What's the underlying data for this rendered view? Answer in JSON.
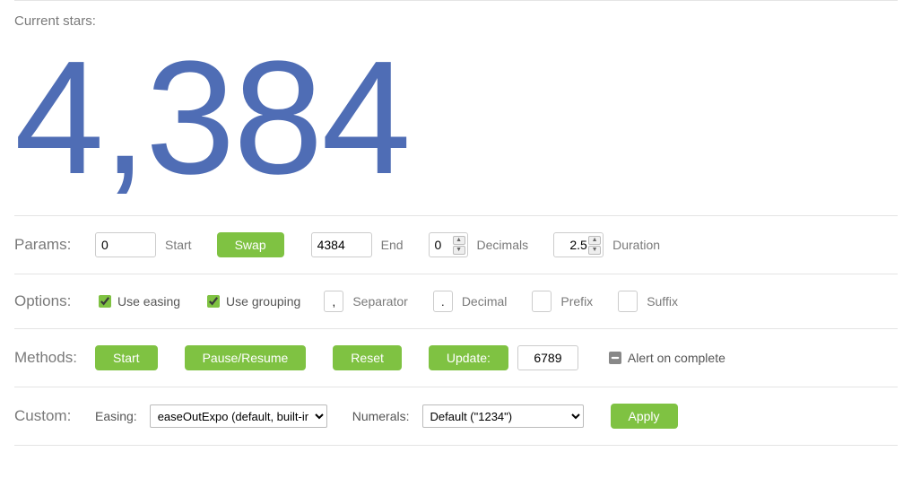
{
  "current": {
    "label": "Current stars:",
    "value": "4,384"
  },
  "params": {
    "section_label": "Params:",
    "start_value": "0",
    "start_label": "Start",
    "swap_button": "Swap",
    "end_value": "4384",
    "end_label": "End",
    "decimals_value": "0",
    "decimals_label": "Decimals",
    "duration_value": "2.5",
    "duration_label": "Duration"
  },
  "options": {
    "section_label": "Options:",
    "use_easing_label": "Use easing",
    "use_grouping_label": "Use grouping",
    "separator_value": ",",
    "separator_label": "Separator",
    "decimal_value": ".",
    "decimal_label": "Decimal",
    "prefix_value": "",
    "prefix_label": "Prefix",
    "suffix_value": "",
    "suffix_label": "Suffix"
  },
  "methods": {
    "section_label": "Methods:",
    "start_button": "Start",
    "pause_resume_button": "Pause/Resume",
    "reset_button": "Reset",
    "update_button": "Update:",
    "update_value": "6789",
    "alert_label": "Alert on complete"
  },
  "custom": {
    "section_label": "Custom:",
    "easing_label": "Easing:",
    "easing_selected": "easeOutExpo (default, built-in)",
    "numerals_label": "Numerals:",
    "numerals_selected": "Default (\"1234\")",
    "apply_button": "Apply"
  }
}
